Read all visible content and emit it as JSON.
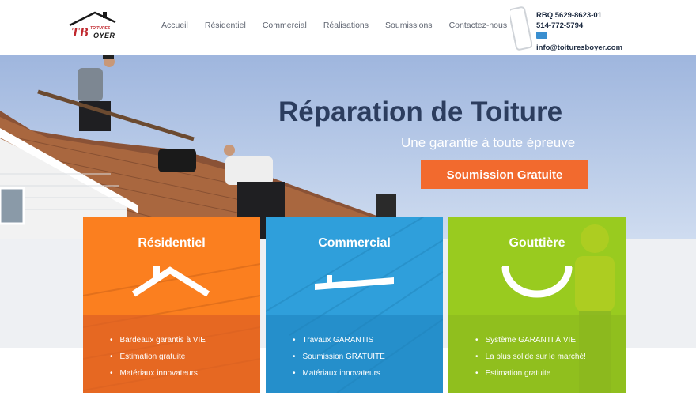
{
  "header": {
    "logo": {
      "brand_main": "OYER",
      "brand_small": "TOITURES",
      "monogram": "TB"
    },
    "nav": [
      "Accueil",
      "Résidentiel",
      "Commercial",
      "Réalisations",
      "Soumissions",
      "Contactez-nous"
    ],
    "contact": {
      "rbq": "RBQ 5629-8623-01",
      "phone": "514-772-5794",
      "email": "info@toituresboyer.com",
      "icons": [
        "phone-icon",
        "mail-icon"
      ]
    }
  },
  "hero": {
    "title": "Réparation de Toiture",
    "subtitle": "Une garantie à toute épreuve",
    "cta_label": "Soumission Gratuite"
  },
  "cards": [
    {
      "title": "Résidentiel",
      "icon": "house-roof-icon",
      "color": "#fb7f1f",
      "items": [
        "Bardeaux garantis à VIE",
        "Estimation gratuite",
        "Matériaux innovateurs"
      ]
    },
    {
      "title": "Commercial",
      "icon": "flat-roof-icon",
      "color": "#2f9fdb",
      "items": [
        "Travaux GARANTIS",
        "Soumission GRATUITE",
        "Matériaux innovateurs"
      ]
    },
    {
      "title": "Gouttière",
      "icon": "gutter-icon",
      "color": "#99cb1f",
      "items": [
        "Système GARANTI À VIE",
        "La plus solide sur le marché!",
        "Estimation gratuite"
      ]
    }
  ],
  "colors": {
    "accent": "#f26a2e",
    "title": "#2c3d5e",
    "nav_text": "#5e6470"
  }
}
